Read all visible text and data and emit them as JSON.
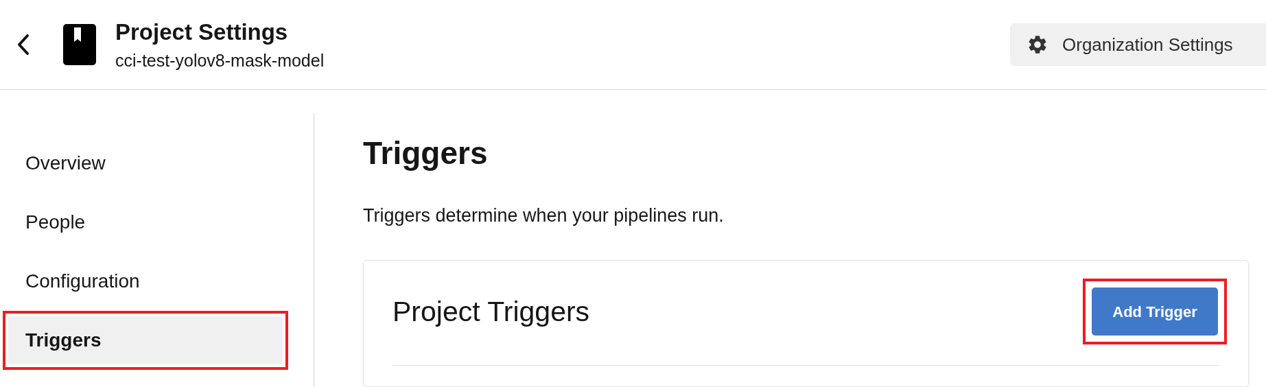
{
  "header": {
    "title": "Project Settings",
    "subtitle": "cci-test-yolov8-mask-model",
    "org_button": "Organization Settings"
  },
  "sidebar": {
    "items": [
      {
        "label": "Overview",
        "selected": false,
        "highlighted": false
      },
      {
        "label": "People",
        "selected": false,
        "highlighted": false
      },
      {
        "label": "Configuration",
        "selected": false,
        "highlighted": false
      },
      {
        "label": "Triggers",
        "selected": true,
        "highlighted": true
      }
    ]
  },
  "main": {
    "heading": "Triggers",
    "description": "Triggers determine when your pipelines run.",
    "card": {
      "title": "Project Triggers",
      "button": {
        "label": "Add Trigger",
        "highlighted": true
      }
    }
  }
}
